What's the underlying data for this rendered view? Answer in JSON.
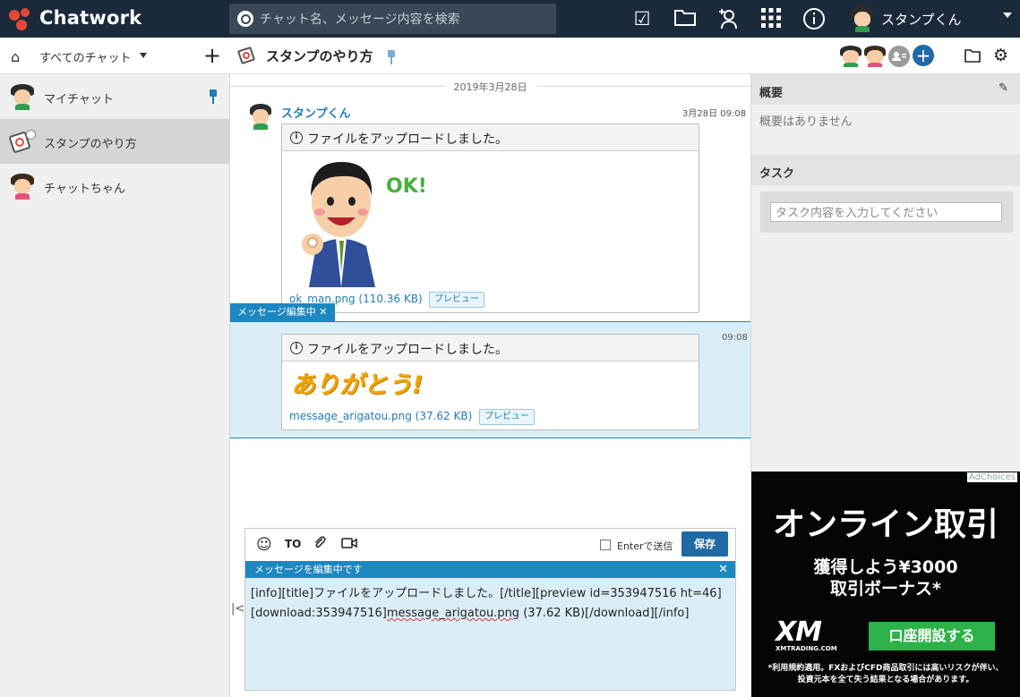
{
  "app": {
    "title": "Chatwork"
  },
  "header": {
    "search_placeholder": "チャット名、メッセージ内容を検索",
    "icons": [
      "task-check-icon",
      "folder-icon",
      "add-contact-icon",
      "grid-apps-icon",
      "info-icon"
    ],
    "user_name": "スタンプくん"
  },
  "sidebar": {
    "filter_label": "すべてのチャット",
    "rooms": [
      {
        "label": "マイチャット",
        "pinned": true
      },
      {
        "label": "スタンプのやり方",
        "selected": true
      },
      {
        "label": "チャットちゃん"
      }
    ]
  },
  "chat": {
    "title": "スタンプのやり方",
    "date": "2019年3月28日",
    "messages": [
      {
        "sender": "スタンプくん",
        "time": "3月28日 09:08",
        "card_title": "ファイルをアップロードしました。",
        "file": "ok_man.png (110.36 KB)",
        "preview": "プレビュー",
        "image_text": "OK!"
      },
      {
        "time": "09:08",
        "card_title": "ファイルをアップロードしました。",
        "file": "message_arigatou.png (37.62 KB)",
        "preview": "プレビュー",
        "image_text": "ありがとう!"
      }
    ],
    "edit_tag": "メッセージ編集中 ✕"
  },
  "composer": {
    "to": "TO",
    "enter_label": "Enterで送信",
    "save": "保存",
    "edit_bar": "メッセージを編集中です",
    "close": "✕",
    "line1": "[info][title]ファイルをアップロードしました。[/title][preview id=353947516 ht=46]",
    "line2_pre": "[download:353947516]",
    "line2_err": "message_arigatou.png",
    "line2_post": " (37.62 KB)[/download][/info]",
    "collapse": "|<"
  },
  "right": {
    "overview_title": "概要",
    "overview_empty": "概要はありません",
    "task_title": "タスク",
    "task_placeholder": "タスク内容を入力してください"
  },
  "ad": {
    "adchoices": "AdChoices",
    "headline": "オンライン取引",
    "line1": "獲得しよう¥3000",
    "line2": "取引ボーナス*",
    "logo": "XM",
    "logo_sub": "XMTRADING.COM",
    "cta": "口座開設する",
    "fine1": "*利用規約適用。FXおよびCFD商品取引には高いリスクが伴い、",
    "fine2": "投資元本を全て失う結果となる場合があります。"
  },
  "colors": {
    "header_bg": "#1b2a3b",
    "accent": "#1d87bf",
    "link": "#1f7db8",
    "save_btn": "#1f6aa5",
    "ad_green": "#2db24a"
  }
}
